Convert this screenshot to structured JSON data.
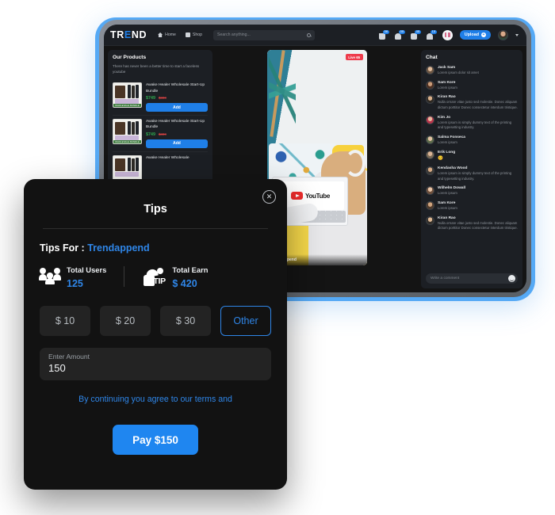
{
  "app": {
    "navbar": {
      "logo_before": "TR",
      "logo_accent": "E",
      "logo_after": "ND",
      "links": [
        {
          "label": "Home",
          "icon": "home-icon"
        },
        {
          "label": "Shop",
          "icon": "shop-icon"
        }
      ],
      "search_placeholder": "Search anything...",
      "badges": [
        {
          "icon": "cart-icon",
          "count": "06"
        },
        {
          "icon": "heart-icon",
          "count": "05"
        },
        {
          "icon": "message-icon",
          "count": "45"
        },
        {
          "icon": "bell-icon",
          "count": "15"
        }
      ],
      "gift_icon": "gift-icon",
      "upload_label": "Upload",
      "upload_plus": "+",
      "avatar": "user-avatar"
    },
    "products_panel": {
      "title": "Our Products",
      "subtitle": "There has never been a better time to start a faceless youtube",
      "add_label": "Add",
      "items": [
        {
          "name": "Awake Healer Wholesale Start-Up Bundle",
          "price_new": "$749",
          "price_old": "$800",
          "img_caption": "WHOLESALE BUNDLE"
        },
        {
          "name": "Awake Healer Wholesale Start-Up Bundle",
          "price_new": "$749",
          "price_old": "$800",
          "img_caption": "WHOLESALE BUNDLE"
        },
        {
          "name": "Awake Healer Wholesale",
          "price_new": "",
          "price_old": "",
          "img_caption": ""
        }
      ]
    },
    "video": {
      "live_label": "Live 65",
      "caption": "Trendappend",
      "brand_on_screen": "YouTube"
    },
    "chat_panel": {
      "title": "Chat",
      "input_placeholder": "Write a comment",
      "emoji_icon": "smiley-icon",
      "messages": [
        {
          "name": "Jack Sam",
          "text": "Lorem ipsum dolor sit amet"
        },
        {
          "name": "Sam Kore",
          "text": "Lorem ipsum"
        },
        {
          "name": "Kiran Rao",
          "text": "Nulla ornare vitae justo sed molestie. Donec aliquam dictum porttitor Donec consectetur interdum tristique."
        },
        {
          "name": "Kim Jo",
          "text": "Lorem ipsum is simply dummy text of the printing and typesetting industry."
        },
        {
          "name": "Salma Fonseca",
          "text": "Lorem ipsum"
        },
        {
          "name": "Erik Long",
          "text": "😊"
        },
        {
          "name": "Kendasha Wood",
          "text": "Lorem ipsum is simply dummy text of the printing and typesetting industry."
        },
        {
          "name": "Wilhelm Dowall",
          "text": "Lorem ipsum"
        },
        {
          "name": "Sam Kore",
          "text": "Lorem ipsum"
        },
        {
          "name": "Kiran Rao",
          "text": "Nulla ornare vitae justo sed molestie. Donec aliquam dictum porttitor Donec consectetur interdum tristique."
        }
      ]
    }
  },
  "modal": {
    "title": "Tips",
    "close_icon": "close-icon",
    "tips_for_label": "Tips For :",
    "tips_for_value": "Trendappend",
    "stats": [
      {
        "icon": "users-icon",
        "label": "Total Users",
        "value": "125"
      },
      {
        "icon": "tip-hand-icon",
        "label": "Total Earn",
        "value": "$ 420"
      }
    ],
    "tip_icon_text": "TIP",
    "amount_options": [
      {
        "label": "$ 10",
        "selected": false
      },
      {
        "label": "$ 20",
        "selected": false
      },
      {
        "label": "$ 30",
        "selected": false
      },
      {
        "label": "Other",
        "selected": true
      }
    ],
    "amount_field": {
      "label": "Enter Amount",
      "value": "150"
    },
    "terms_text": "By continuing you agree to our terms and",
    "pay_label": "Pay $150"
  },
  "colors": {
    "accent_blue": "#2f86e8",
    "button_blue": "#1f86f0",
    "price_green": "#2fa84f",
    "price_red": "#d94343",
    "live_red": "#ee3b4b",
    "modal_bg": "#121212",
    "panel_bg": "#1c1f24"
  }
}
